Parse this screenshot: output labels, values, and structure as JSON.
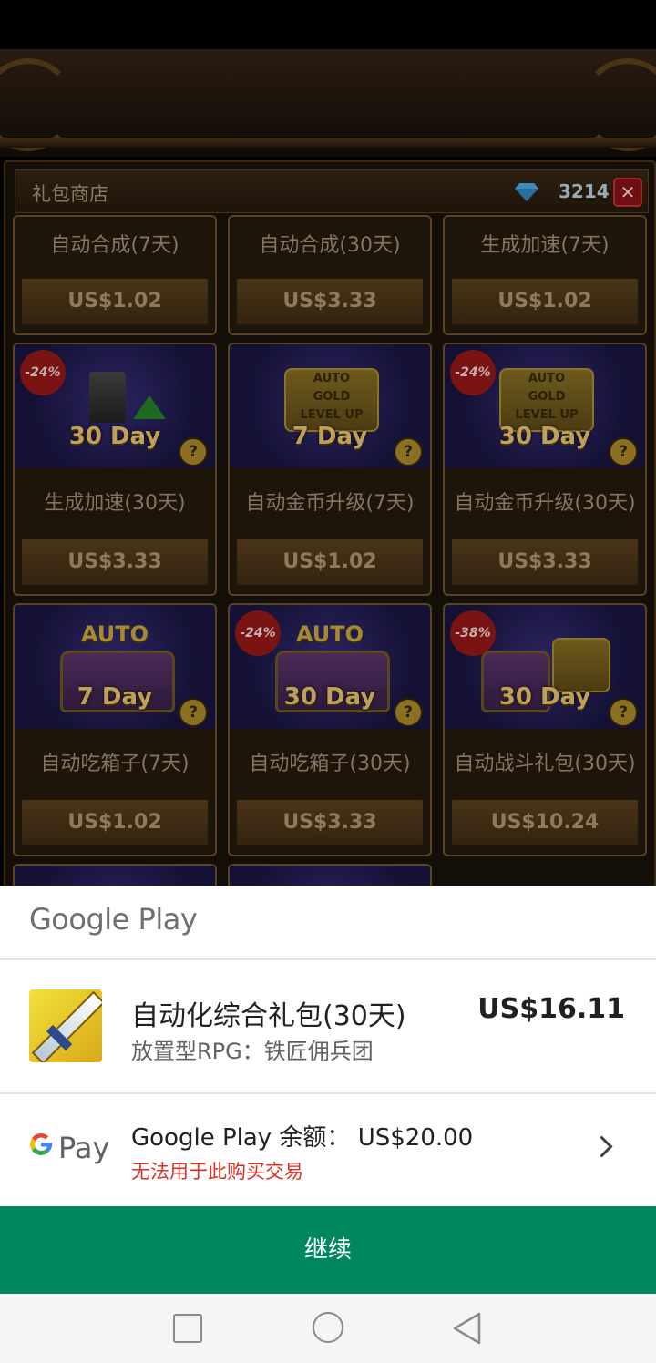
{
  "game": {
    "shop_title": "礼包商店",
    "gem_count": "3214",
    "close_label": "✕",
    "cards": [
      {
        "name": "自动合成(7天)",
        "price": "US$1.02"
      },
      {
        "name": "自动合成(30天)",
        "price": "US$3.33"
      },
      {
        "name": "生成加速(7天)",
        "price": "US$1.02"
      },
      {
        "name": "生成加速(30天)",
        "price": "US$3.33",
        "discount": "-24%",
        "day_label": "30 Day"
      },
      {
        "name": "自动金币升级(7天)",
        "price": "US$1.02",
        "day_label": "7 Day",
        "emblem": [
          "AUTO",
          "GOLD",
          "LEVEL UP"
        ]
      },
      {
        "name": "自动金币升级(30天)",
        "price": "US$3.33",
        "discount": "-24%",
        "day_label": "30 Day",
        "emblem": [
          "AUTO",
          "GOLD",
          "LEVEL UP"
        ]
      },
      {
        "name": "自动吃箱子(7天)",
        "price": "US$1.02",
        "day_label": "7 Day",
        "banner": "AUTO"
      },
      {
        "name": "自动吃箱子(30天)",
        "price": "US$3.33",
        "discount": "-24%",
        "day_label": "30 Day",
        "banner": "AUTO"
      },
      {
        "name": "自动战斗礼包(30天)",
        "price": "US$10.24",
        "discount": "-38%",
        "day_label": "30 Day"
      }
    ],
    "help_label": "?"
  },
  "payment": {
    "brand": "Google Play",
    "product_title": "自动化综合礼包(30天)",
    "product_app": "放置型RPG：铁匠佣兵团",
    "product_price": "US$16.11",
    "gpay_g": "G",
    "gpay_pay": "Pay",
    "balance_label": "Google Play 余额： US$20.00",
    "warning": "无法用于此购买交易",
    "continue_label": "继续"
  },
  "colors": {
    "continue_bg": "#01875f",
    "warning": "#d93025"
  }
}
